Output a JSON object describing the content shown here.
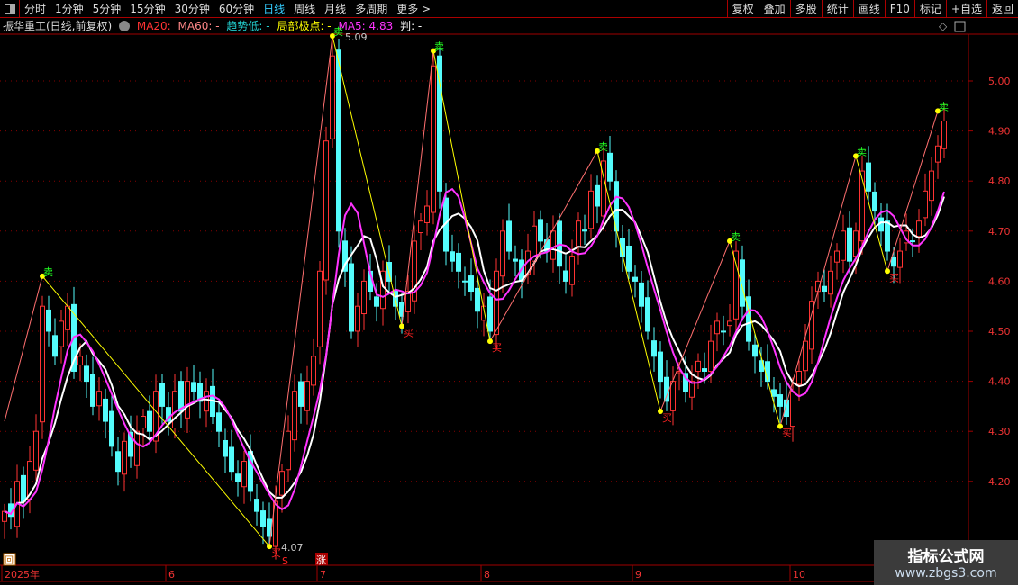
{
  "toolbar": {
    "periods": [
      "分时",
      "1分钟",
      "5分钟",
      "15分钟",
      "30分钟",
      "60分钟",
      "日线",
      "周线",
      "月线",
      "多周期",
      "更多 >"
    ],
    "active": "日线",
    "right": [
      "复权",
      "叠加",
      "多股",
      "统计",
      "画线",
      "F10",
      "标记",
      "+自选",
      "返回"
    ]
  },
  "info": {
    "title": "振华重工(日线,前复权)",
    "ma20": "MA20: ",
    "ma60": "MA60: -",
    "trend": "趋势低: -",
    "extreme": "局部极点: -",
    "ma5": "MA5: 4.83",
    "judge": "判: -"
  },
  "colors": {
    "up": "#ff3333",
    "down": "#54fcfc",
    "ma5": "#ff33ff",
    "ma_white": "#ffffff",
    "zig_down": "#ffff00",
    "zig_up": "#ff7070",
    "axis": "#a00000"
  },
  "markers": {
    "sell": "卖",
    "buy": "买",
    "high_label": "5.09",
    "low_label": "4.07",
    "s_badge": "S",
    "zhang_badge": "涨",
    "back_badge": "回"
  },
  "watermark": {
    "line1": "指标公式网",
    "line2": "www.zbgs3.com"
  },
  "chart_data": {
    "type": "candlestick",
    "ylim": [
      4.07,
      5.09
    ],
    "yticks": [
      "5.00",
      "4.90",
      "4.80",
      "4.70",
      "4.60",
      "4.50",
      "4.40",
      "4.30",
      "4.20"
    ],
    "xticks": [
      {
        "label": "2025年",
        "index": 0
      },
      {
        "label": "6",
        "index": 26
      },
      {
        "label": "7",
        "index": 50
      },
      {
        "label": "8",
        "index": 76
      },
      {
        "label": "9",
        "index": 100
      },
      {
        "label": "10",
        "index": 125
      }
    ],
    "close": [
      4.14,
      4.13,
      4.2,
      4.16,
      4.24,
      4.3,
      4.55,
      4.5,
      4.45,
      4.52,
      4.55,
      4.42,
      4.45,
      4.4,
      4.35,
      4.38,
      4.32,
      4.27,
      4.22,
      4.28,
      4.25,
      4.3,
      4.33,
      4.3,
      4.38,
      4.35,
      4.32,
      4.38,
      4.34,
      4.4,
      4.38,
      4.36,
      4.38,
      4.33,
      4.3,
      4.25,
      4.22,
      4.2,
      4.24,
      4.18,
      4.14,
      4.11,
      4.09,
      4.16,
      4.22,
      4.3,
      4.38,
      4.35,
      4.4,
      4.45,
      4.62,
      4.88,
      5.05,
      4.7,
      4.62,
      4.5,
      4.55,
      4.6,
      4.58,
      4.55,
      4.62,
      4.6,
      4.55,
      4.53,
      4.58,
      4.68,
      4.72,
      4.75,
      5.03,
      4.78,
      4.66,
      4.64,
      4.62,
      4.6,
      4.58,
      4.54,
      4.55,
      4.5,
      4.62,
      4.7,
      4.66,
      4.64,
      4.6,
      4.66,
      4.71,
      4.68,
      4.66,
      4.7,
      4.63,
      4.6,
      4.65,
      4.72,
      4.7,
      4.78,
      4.75,
      4.84,
      4.8,
      4.7,
      4.65,
      4.62,
      4.6,
      4.55,
      4.5,
      4.45,
      4.4,
      4.36,
      4.4,
      4.42,
      4.38,
      4.4,
      4.44,
      4.42,
      4.48,
      4.52,
      4.5,
      4.52,
      4.66,
      4.55,
      4.48,
      4.45,
      4.42,
      4.4,
      4.37,
      4.35,
      4.33,
      4.38,
      4.42,
      4.48,
      4.56,
      4.6,
      4.58,
      4.62,
      4.66,
      4.7,
      4.64,
      4.7,
      4.82,
      4.78,
      4.74,
      4.7,
      4.66,
      4.63,
      4.66,
      4.7,
      4.68,
      4.72,
      4.78,
      4.82,
      4.87,
      4.92
    ],
    "pivots": [
      {
        "index": 6,
        "price": 4.61,
        "type": "sell"
      },
      {
        "index": 42,
        "price": 4.07,
        "type": "buy"
      },
      {
        "index": 52,
        "price": 5.09,
        "type": "sell"
      },
      {
        "index": 63,
        "price": 4.51,
        "type": "buy"
      },
      {
        "index": 68,
        "price": 5.06,
        "type": "sell"
      },
      {
        "index": 77,
        "price": 4.48,
        "type": "buy"
      },
      {
        "index": 94,
        "price": 4.86,
        "type": "sell"
      },
      {
        "index": 104,
        "price": 4.34,
        "type": "buy"
      },
      {
        "index": 115,
        "price": 4.68,
        "type": "sell"
      },
      {
        "index": 123,
        "price": 4.31,
        "type": "buy"
      },
      {
        "index": 135,
        "price": 4.85,
        "type": "sell"
      },
      {
        "index": 140,
        "price": 4.62,
        "type": "buy"
      },
      {
        "index": 148,
        "price": 4.94,
        "type": "sell"
      }
    ]
  }
}
